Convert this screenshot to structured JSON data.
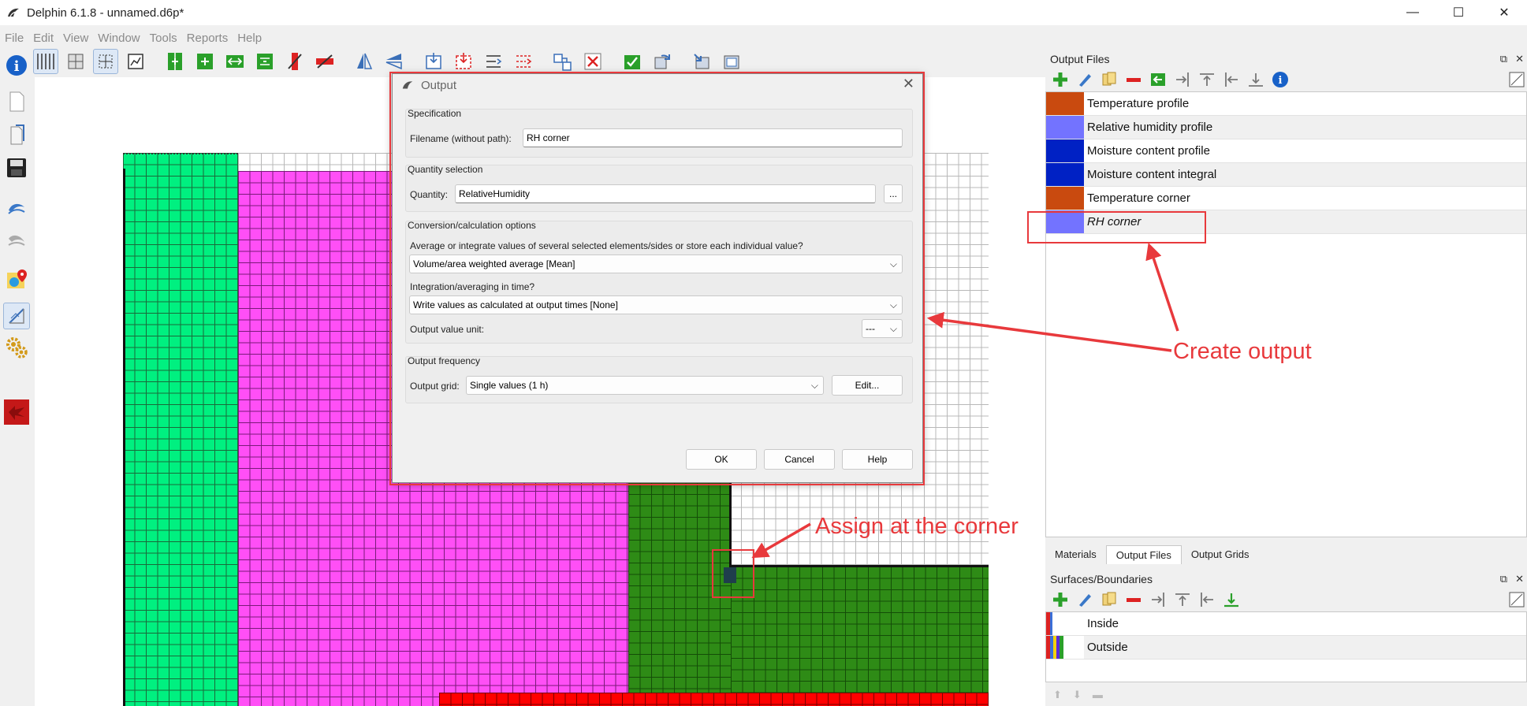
{
  "window": {
    "title": "Delphin 6.1.8 - unnamed.d6p*",
    "controls": [
      "—",
      "☐",
      "✕"
    ]
  },
  "menu": [
    "File",
    "Edit",
    "View",
    "Window",
    "Tools",
    "Reports",
    "Help"
  ],
  "output_files_panel": {
    "title": "Output Files",
    "items": [
      {
        "label": "Temperature profile",
        "color": "#c94a0f"
      },
      {
        "label": "Relative humidity profile",
        "color": "#7373ff"
      },
      {
        "label": "Moisture content profile",
        "color": "#0021c4"
      },
      {
        "label": "Moisture content integral",
        "color": "#0021c4"
      },
      {
        "label": "Temperature corner",
        "color": "#c94a0f"
      },
      {
        "label": "RH corner",
        "color": "#7373ff"
      }
    ]
  },
  "tabs": [
    "Materials",
    "Output Files",
    "Output Grids"
  ],
  "active_tab": "Output Files",
  "surfaces_panel": {
    "title": "Surfaces/Boundaries",
    "items": [
      {
        "label": "Inside"
      },
      {
        "label": "Outside"
      }
    ]
  },
  "dialog": {
    "title": "Output",
    "specification": {
      "group_title": "Specification",
      "filename_label": "Filename (without path):",
      "filename_value": "RH corner"
    },
    "quantity": {
      "group_title": "Quantity selection",
      "label": "Quantity:",
      "value": "RelativeHumidity",
      "browse_label": "..."
    },
    "conversion": {
      "group_title": "Conversion/calculation options",
      "average_question": "Average or integrate values of several selected elements/sides or store each individual value?",
      "average_value": "Volume/area weighted average [Mean]",
      "time_question": "Integration/averaging in time?",
      "time_value": "Write values as calculated at output times [None]",
      "unit_label": "Output value unit:",
      "unit_value": "---"
    },
    "frequency": {
      "group_title": "Output frequency",
      "grid_label": "Output grid:",
      "grid_value": "Single values (1 h)",
      "edit_label": "Edit..."
    },
    "buttons": {
      "ok": "OK",
      "cancel": "Cancel",
      "help": "Help"
    }
  },
  "annotations": {
    "create_output": "Create output",
    "assign_corner": "Assign at the corner",
    "color": "#e8393c"
  }
}
